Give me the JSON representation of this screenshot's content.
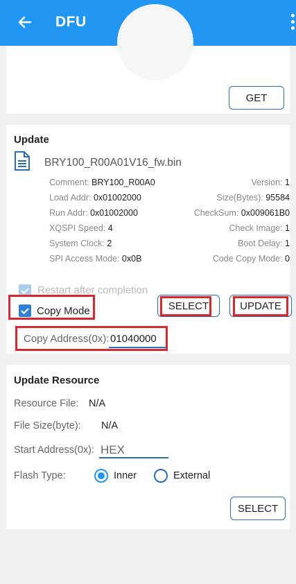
{
  "appbar": {
    "title": "DFU"
  },
  "device_card": {
    "get_button": "GET"
  },
  "update": {
    "section_title": "Update",
    "file_name": "BRY100_R00A01V16_fw.bin",
    "info_left": [
      {
        "label": "Comment: ",
        "value": "BRY100_R00A0"
      },
      {
        "label": "Load Addr: ",
        "value": "0x01002000"
      },
      {
        "label": "Run Addr: ",
        "value": "0x01002000"
      },
      {
        "label": "XQSPI Speed: ",
        "value": "4"
      },
      {
        "label": "System Clock: ",
        "value": "2"
      },
      {
        "label": "SPI Access Mode: ",
        "value": "0x0B"
      }
    ],
    "info_right": [
      {
        "label": "Version: ",
        "value": "1"
      },
      {
        "label": "Size(Bytes): ",
        "value": "95584"
      },
      {
        "label": "CheckSum: ",
        "value": "0x009061B0"
      },
      {
        "label": "Check Image: ",
        "value": "1"
      },
      {
        "label": "Boot Delay: ",
        "value": "1"
      },
      {
        "label": "Code Copy Mode: ",
        "value": "0"
      }
    ],
    "restart_label": "Restart after completion",
    "restart_checked": true,
    "copy_mode_label": "Copy Mode",
    "copy_mode_checked": true,
    "select_button": "SELECT",
    "update_button": "UPDATE",
    "copy_address_label": "Copy Address(0x): ",
    "copy_address_value": "01040000"
  },
  "resource": {
    "section_title": "Update Resource",
    "resource_file_label": "Resource File:",
    "resource_file_value": "N/A",
    "file_size_label": "File Size(byte):",
    "file_size_value": "N/A",
    "start_address_label": "Start Address(0x):",
    "start_address_placeholder": "HEX",
    "flash_type_label": "Flash Type:",
    "flash_options": [
      "Inner",
      "External"
    ],
    "flash_selected": "Inner",
    "select_button": "SELECT"
  },
  "colors": {
    "primary": "#2196f3",
    "highlight": "#d9262f",
    "checkbox": "#2f7fd6"
  }
}
